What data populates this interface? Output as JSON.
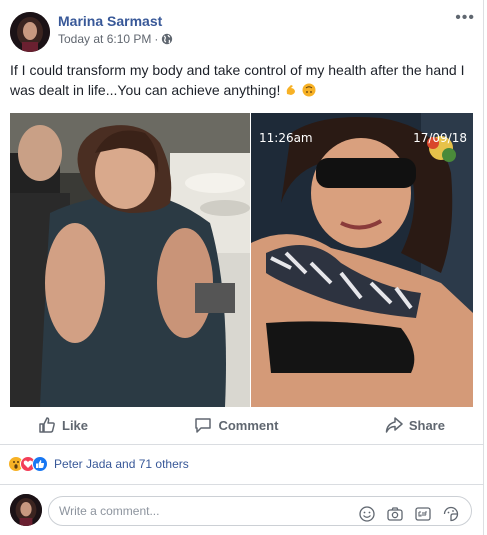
{
  "post": {
    "author": "Marina Sarmast",
    "timestamp": "Today at 6:10 PM",
    "privacy_icon": "globe-icon",
    "more_icon": "more-options-icon",
    "more_label": "•••",
    "text": "If I could transform my body and take control of my health after the hand I was dealt in life...You can achieve anything!",
    "emojis": [
      "flexed-biceps-emoji",
      "upside-down-face-emoji"
    ]
  },
  "photo_overlay": {
    "time": "11:26am",
    "date": "17/09/18"
  },
  "actions": {
    "like": "Like",
    "comment": "Comment",
    "share": "Share"
  },
  "reactions": {
    "icons": [
      "wow-reaction-icon",
      "love-reaction-icon",
      "like-reaction-icon"
    ],
    "summary": "Peter Jada and 71 others"
  },
  "comment_box": {
    "placeholder": "Write a comment...",
    "tools": [
      "emoji-icon",
      "camera-icon",
      "gif-icon",
      "sticker-icon"
    ]
  },
  "colors": {
    "author_link": "#385898",
    "meta_text": "#616770",
    "action_text": "#606770",
    "divider": "#dadde1",
    "like_blue": "#1877f2",
    "love_red": "#f33e58",
    "wow_yellow": "#f7b125"
  }
}
